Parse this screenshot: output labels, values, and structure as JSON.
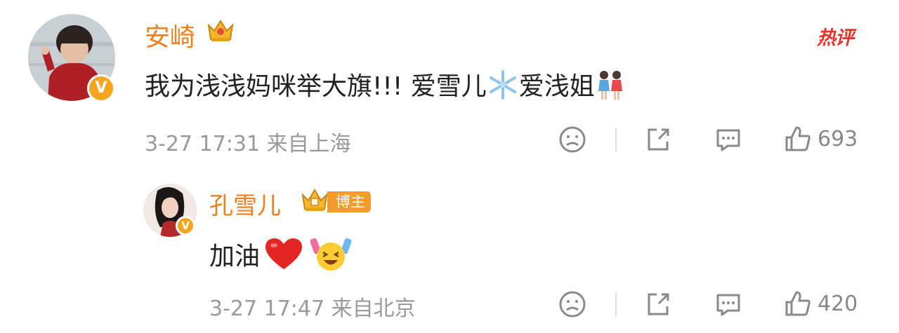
{
  "hot_label": "热评",
  "comment": {
    "username": "安崎",
    "text_before": "我为浅浅妈咪举大旗!!! 爱雪儿",
    "text_after": "爱浅姐",
    "timestamp": "3-27 17:31",
    "location": "来自上海",
    "likes": "693",
    "verified_badge": "V"
  },
  "reply": {
    "username": "孔雪儿",
    "role_badge": "博主",
    "text": "加油",
    "timestamp": "3-27 17:47",
    "location": "来自北京",
    "likes": "420",
    "verified_badge": "V"
  },
  "icons": {
    "crown": "crown-icon",
    "snowflake": "snowflake-emoji",
    "twins": "women-holding-hands-emoji",
    "heart": "red-heart-emoji",
    "cheer": "cheering-face-emoji",
    "dislike": "sad-face-icon",
    "share": "share-icon",
    "comment": "comment-icon",
    "like": "thumbs-up-icon"
  },
  "colors": {
    "username": "#f07f1e",
    "hot": "#e9342c",
    "badge": "#f59a2d",
    "meta": "#9a9a9a"
  }
}
